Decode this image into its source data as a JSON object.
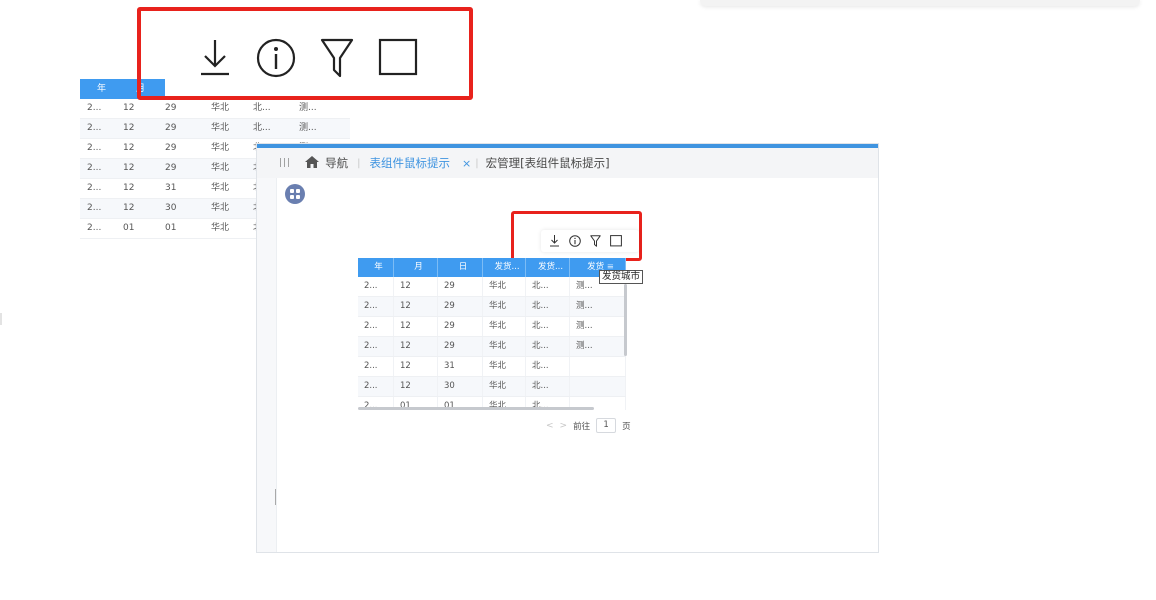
{
  "toolbar": {
    "icons": [
      "download-icon",
      "info-icon",
      "filter-icon",
      "square-icon"
    ],
    "highlight_color": "#e8221c"
  },
  "breadcrumb": {
    "home_label": "导航",
    "active_tab": "表组件鼠标提示",
    "close_symbol": "×",
    "current_page": "宏管理[表组件鼠标提示]"
  },
  "bg_grid": {
    "headers": [
      "年",
      "月"
    ],
    "rows": [
      [
        "2...",
        "12",
        "29",
        "华北",
        "北...",
        "测..."
      ],
      [
        "2...",
        "12",
        "29",
        "华北",
        "北...",
        "测..."
      ],
      [
        "2...",
        "12",
        "29",
        "华北",
        "北",
        "测..."
      ],
      [
        "2...",
        "12",
        "29",
        "华北",
        "北",
        ""
      ],
      [
        "2...",
        "12",
        "31",
        "华北",
        "北",
        ""
      ],
      [
        "2...",
        "12",
        "30",
        "华北",
        "北",
        ""
      ],
      [
        "2...",
        "01",
        "01",
        "华北",
        "北",
        ""
      ]
    ]
  },
  "grid": {
    "headers": [
      "年",
      "月",
      "日",
      "发货...",
      "发货...",
      "发货"
    ],
    "rows": [
      [
        "2...",
        "12",
        "29",
        "华北",
        "北...",
        "测..."
      ],
      [
        "2...",
        "12",
        "29",
        "华北",
        "北...",
        "测..."
      ],
      [
        "2...",
        "12",
        "29",
        "华北",
        "北...",
        "测..."
      ],
      [
        "2...",
        "12",
        "29",
        "华北",
        "北...",
        "测..."
      ],
      [
        "2...",
        "12",
        "31",
        "华北",
        "北...",
        ""
      ],
      [
        "2...",
        "12",
        "30",
        "华北",
        "北...",
        ""
      ],
      [
        "2...",
        "01",
        "01",
        "华北",
        "北...",
        ""
      ]
    ]
  },
  "tooltip": {
    "text": "发货城市"
  },
  "pager": {
    "prev": "<",
    "next": ">",
    "goto_label": "前往",
    "page_value": "1",
    "page_unit": "页"
  },
  "colors": {
    "header_blue": "#3f9bf0",
    "accent_blue": "#3f94e0",
    "app_button": "#6a7fb0"
  }
}
